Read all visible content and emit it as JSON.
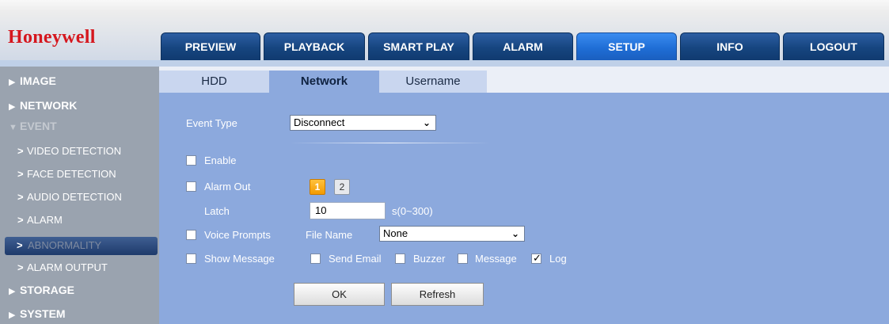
{
  "brand": "Honeywell",
  "nav": {
    "tabs": [
      "PREVIEW",
      "PLAYBACK",
      "SMART PLAY",
      "ALARM",
      "SETUP",
      "INFO",
      "LOGOUT"
    ],
    "active": "SETUP"
  },
  "sidebar": {
    "top": {
      "image": "IMAGE",
      "network": "NETWORK",
      "event": "EVENT",
      "storage": "STORAGE",
      "system": "SYSTEM"
    },
    "sub": {
      "video": "VIDEO DETECTION",
      "face": "FACE DETECTION",
      "audio": "AUDIO DETECTION",
      "alarm": "ALARM",
      "abnormality": "ABNORMALITY",
      "alarm_output": "ALARM OUTPUT"
    },
    "selected": "ABNORMALITY"
  },
  "subtabs": {
    "hdd": "HDD",
    "network": "Network",
    "username": "Username",
    "active": "Network"
  },
  "form": {
    "event_type_label": "Event Type",
    "event_type_value": "Disconnect",
    "enable_label": "Enable",
    "alarm_out_label": "Alarm Out",
    "alarm_out_buttons": [
      "1",
      "2"
    ],
    "alarm_out_selected": "1",
    "latch_label": "Latch",
    "latch_value": "10",
    "latch_unit": "s(0~300)",
    "voice_prompts_label": "Voice Prompts",
    "file_name_label": "File Name",
    "file_name_value": "None",
    "show_message_label": "Show Message",
    "send_email_label": "Send Email",
    "buzzer_label": "Buzzer",
    "message_label": "Message",
    "log_label": "Log",
    "checks": {
      "enable": false,
      "alarm_out": false,
      "voice_prompts": false,
      "show_message": false,
      "send_email": false,
      "buzzer": false,
      "message": false,
      "log": true
    }
  },
  "buttons": {
    "ok": "OK",
    "refresh": "Refresh"
  },
  "colors": {
    "brand": "#d5171e",
    "nav_active": "#1f6ed6",
    "panel": "#8ca9dd",
    "sidebar": "#9aa3af",
    "highlight": "#f39a00"
  },
  "icons": {
    "dropdown": "chevron-down-icon",
    "expand": "triangle-right-icon",
    "collapse": "triangle-down-icon",
    "check": "check-icon"
  }
}
